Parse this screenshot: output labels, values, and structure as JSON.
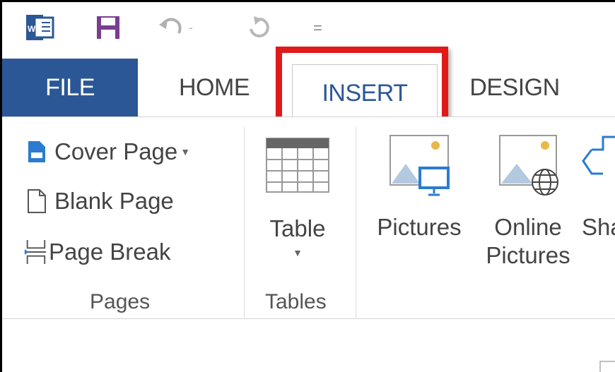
{
  "quick_access": {
    "icons": [
      "word-icon",
      "save-icon",
      "undo-icon",
      "redo-icon",
      "customize-icon"
    ],
    "customize_glyph": "="
  },
  "tabs": {
    "file": "FILE",
    "home": "HOME",
    "insert": "INSERT",
    "design": "DESIGN"
  },
  "groups": {
    "pages": {
      "label": "Pages",
      "cover_page": "Cover Page",
      "blank_page": "Blank Page",
      "page_break": "Page Break"
    },
    "tables": {
      "label": "Tables",
      "table": "Table"
    },
    "illustrations": {
      "pictures": "Pictures",
      "online_pictures_1": "Online",
      "online_pictures_2": "Pictures",
      "shapes_partial": "Sha"
    }
  },
  "colors": {
    "file_tab": "#2b5797",
    "highlight": "#e11919",
    "word_icon": "#2b5797",
    "save_icon": "#7a3d8f"
  }
}
